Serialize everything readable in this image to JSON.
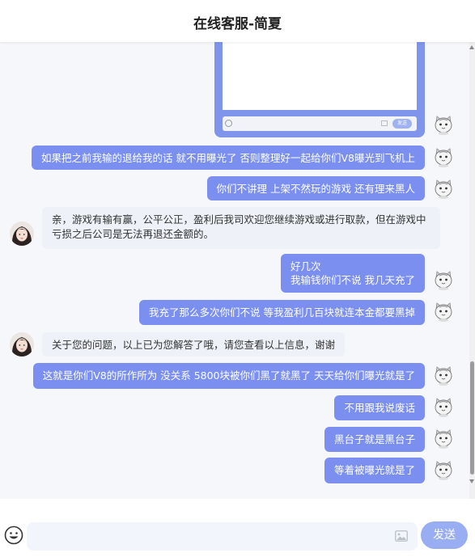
{
  "header": {
    "title": "在线客服-简夏"
  },
  "screenshot_card": {
    "send_label": "发送"
  },
  "messages": [
    {
      "side": "out",
      "text": "如果把之前我输的退给我的话 就不用曝光了 否则整理好一起给你们V8曝光到飞机上"
    },
    {
      "side": "out",
      "text": "你们不讲理  上架不然玩的游戏 还有理来黑人"
    },
    {
      "side": "in",
      "text": "亲，游戏有输有赢，公平公正，盈利后我司欢迎您继续游戏或进行取款，但在游戏中亏损之后公司是无法再退还金额的。"
    },
    {
      "side": "out",
      "line1": "好几次",
      "line2": "我输钱你们不说 我几天充了"
    },
    {
      "side": "out",
      "text": "我充了那么多次你们不说  等我盈利几百块就连本金都要黑掉"
    },
    {
      "side": "in",
      "text": "关于您的问题，以上已为您解答了哦，请您查看以上信息，谢谢"
    },
    {
      "side": "out",
      "text": "这就是你们V8的所作所为 没关系 5800块被你们黑了就黑了 天天给你们曝光就是了"
    },
    {
      "side": "out",
      "text": "不用跟我说废话"
    },
    {
      "side": "out",
      "text": "黑台子就是黑台子"
    },
    {
      "side": "out",
      "text": "等着被曝光就是了"
    }
  ],
  "composer": {
    "placeholder": "",
    "send_label": "发送"
  },
  "icons": {
    "emoji": "smile-icon",
    "image": "image-icon",
    "user_avatar": "cat-avatar-icon",
    "agent_avatar": "agent-avatar-icon"
  },
  "colors": {
    "outgoing_bubble": "#7b8ff0",
    "incoming_bubble": "#eef1f7",
    "send_button": "#98adf2"
  }
}
